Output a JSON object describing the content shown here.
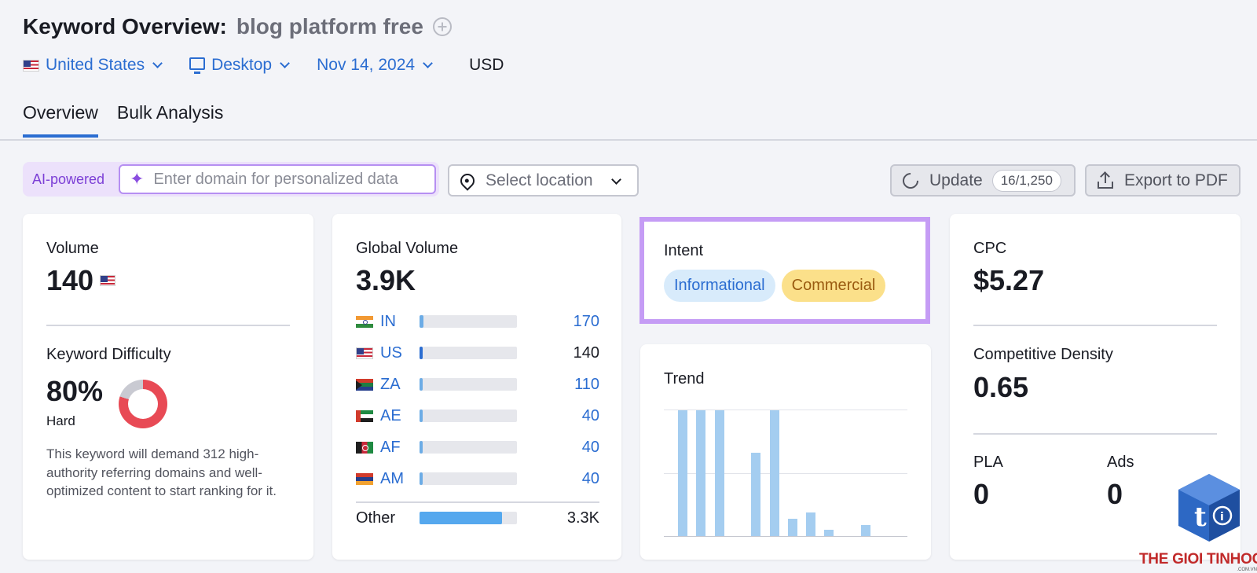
{
  "header": {
    "title": "Keyword Overview:",
    "keyword": "blog platform free"
  },
  "filters": {
    "country": "United States",
    "device": "Desktop",
    "date": "Nov 14, 2024",
    "currency": "USD"
  },
  "tabs": [
    {
      "label": "Overview",
      "active": true
    },
    {
      "label": "Bulk Analysis",
      "active": false
    }
  ],
  "toolbar": {
    "ai_label": "AI-powered",
    "domain_placeholder": "Enter domain for personalized data",
    "location_placeholder": "Select location",
    "update_label": "Update",
    "update_count": "16/1,250",
    "export_label": "Export to PDF"
  },
  "volume_card": {
    "label": "Volume",
    "value": "140",
    "kd_label": "Keyword Difficulty",
    "kd_value": "80%",
    "kd_level": "Hard",
    "kd_percent": 80,
    "kd_description": "This keyword will demand 312 high-authority referring domains and well-optimized content to start ranking for it."
  },
  "global_card": {
    "label": "Global Volume",
    "value": "3.9K",
    "countries": [
      {
        "code": "IN",
        "value": "170",
        "share": 0.04,
        "highlight": false
      },
      {
        "code": "US",
        "value": "140",
        "share": 0.035,
        "highlight": true
      },
      {
        "code": "ZA",
        "value": "110",
        "share": 0.03,
        "highlight": false
      },
      {
        "code": "AE",
        "value": "40",
        "share": 0.02,
        "highlight": false
      },
      {
        "code": "AF",
        "value": "40",
        "share": 0.02,
        "highlight": false
      },
      {
        "code": "AM",
        "value": "40",
        "share": 0.02,
        "highlight": false
      }
    ],
    "other_label": "Other",
    "other_value": "3.3K",
    "other_share": 0.85
  },
  "intent_card": {
    "label": "Intent",
    "tags": [
      "Informational",
      "Commercial"
    ],
    "highlight_color": "#c59cf5"
  },
  "trend_card": {
    "label": "Trend",
    "values": [
      1,
      1,
      1,
      0,
      0.66,
      1,
      0.14,
      0.19,
      0.05,
      0,
      0.09,
      0
    ]
  },
  "cpc_card": {
    "cpc_label": "CPC",
    "cpc_value": "$5.27",
    "density_label": "Competitive Density",
    "density_value": "0.65",
    "pla_label": "PLA",
    "pla_value": "0",
    "ads_label": "Ads",
    "ads_value": "0"
  },
  "watermark": {
    "text": "THE GIOI TINHOC",
    "sub": ".COM.VN"
  },
  "colors": {
    "accent": "#2b6dd1",
    "kd_red": "#e84a55",
    "trend_bar": "#a4cdf0",
    "informational": "#d8ebfb",
    "commercial": "#fbe08a"
  }
}
